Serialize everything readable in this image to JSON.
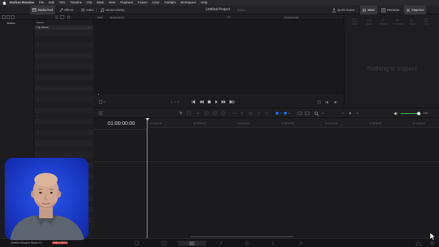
{
  "menubar": {
    "items": [
      "DaVinci Resolve",
      "File",
      "Edit",
      "Trim",
      "Timeline",
      "Clip",
      "Mark",
      "View",
      "Playback",
      "Fusion",
      "Color",
      "Fairlight",
      "Workspace",
      "Help"
    ]
  },
  "toolbar": {
    "media_pool": "Media Pool",
    "effects": "Effects",
    "index": "Index",
    "sound_library": "Sound Library",
    "project_title": "Untitled Project",
    "project_status": "Edited",
    "quick_export": "Quick Export",
    "mixer": "Mixer",
    "metadata": "Metadata",
    "inspector": "Inspector"
  },
  "bar2": {
    "zoom": "29%",
    "timecode_left": "00:00:00:01",
    "timecode_right": "00:00:00:00"
  },
  "media": {
    "bin_header": "Master",
    "clip_header": "Master",
    "column_label": "Clip Name"
  },
  "inspector": {
    "tabs": [
      "Video",
      "Audio",
      "Effects",
      "Transition",
      "Image",
      "File"
    ],
    "empty_text": "Nothing to inspect"
  },
  "timeline": {
    "timecode": "01:00:00:00",
    "ruler": [
      "01:00:00:00",
      "01:00:06:12",
      "01:00:12:24",
      "01:00:19:06",
      "01:00:25:18",
      "01:00:32:00",
      "01:00:38:12"
    ],
    "volume_label": "DIM"
  },
  "footer": {
    "app_name": "DaVinci Resolve Studio 19",
    "badge": "PUBLIC BETA"
  },
  "colors": {
    "accent_blue": "#1f6bd6",
    "playhead": "#9ea0a6",
    "volume_green": "#3fcf5a",
    "webcam_bg": "#1c3fd6"
  }
}
